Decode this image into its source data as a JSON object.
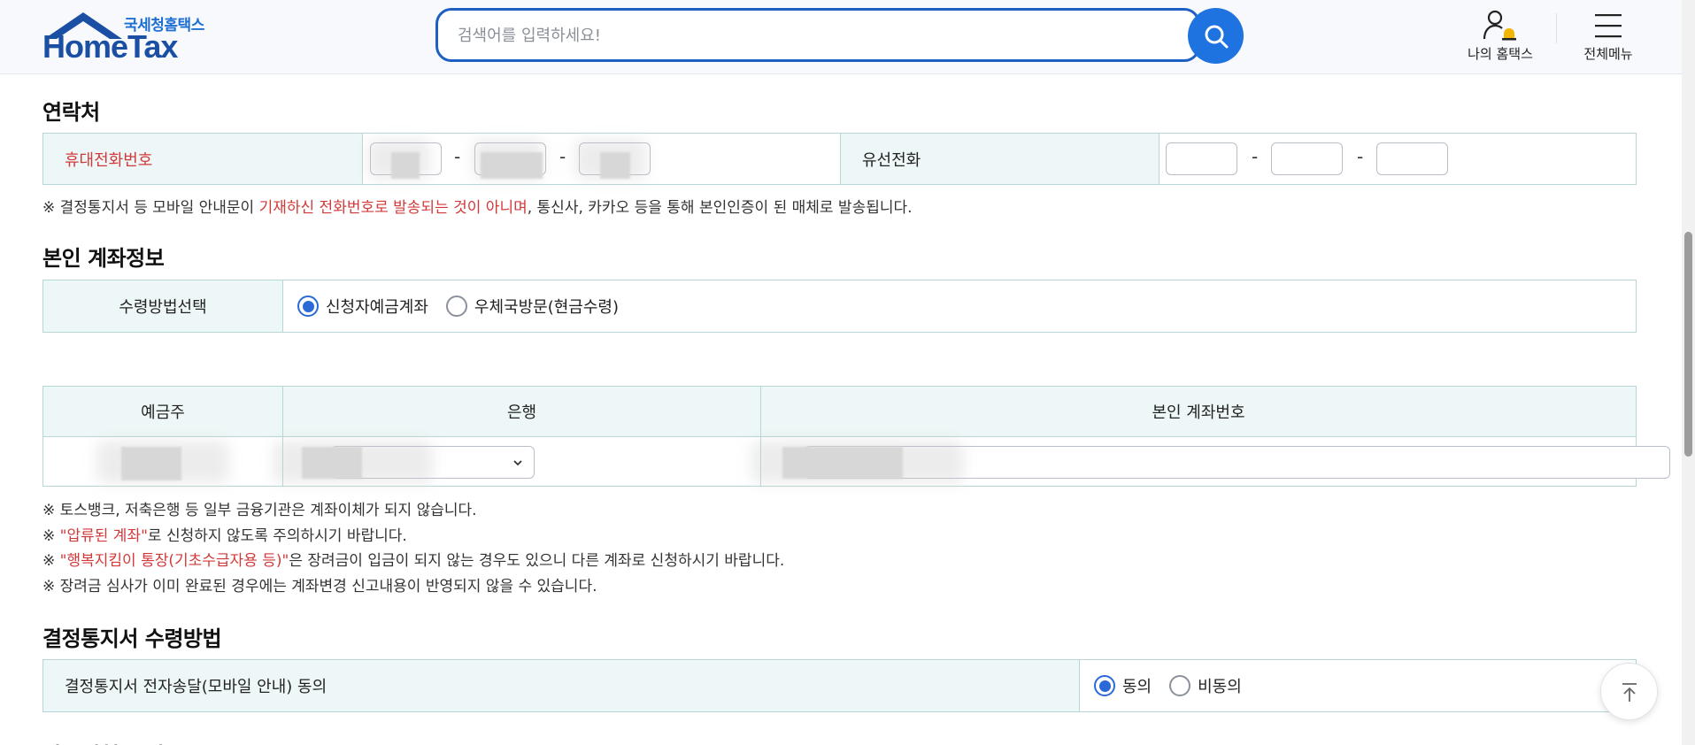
{
  "header": {
    "logo_sub": "국세청홈택스",
    "logo_main": "HomeTax",
    "search_placeholder": "검색어를 입력하세요!",
    "my_hometax": "나의 홈택스",
    "all_menu": "전체메뉴"
  },
  "contact": {
    "title": "연락처",
    "mobile_label": "휴대전화번호",
    "landline_label": "유선전화",
    "dash": "-",
    "note_prefix": "※ 결정통지서 등 모바일 안내문이 ",
    "note_red": "기재하신 전화번호로 발송되는 것이 아니며",
    "note_suffix": ", 통신사, 카카오 등을 통해 본인인증이 된 매체로 발송됩니다."
  },
  "account": {
    "title": "본인 계좌정보",
    "method_label": "수령방법선택",
    "option_deposit": "신청자예금계좌",
    "option_post": "우체국방문(현금수령)",
    "selected": "신청자예금계좌",
    "col_holder": "예금주",
    "col_bank": "은행",
    "col_number": "본인 계좌번호",
    "notes": [
      {
        "prefix": "※ 토스뱅크, 저축은행 등 일부 금융기관은 계좌이체가 되지 않습니다.",
        "red": "",
        "suffix": ""
      },
      {
        "prefix": "※ ",
        "red": "\"압류된 계좌\"",
        "suffix": "로 신청하지 않도록 주의하시기 바랍니다."
      },
      {
        "prefix": "※ ",
        "red": "\"행복지킴이 통장(기초수급자용 등)\"",
        "suffix": "은 장려금이 입금이 되지 않는 경우도 있으니 다른 계좌로 신청하시기 바랍니다."
      },
      {
        "prefix": "※ 장려금 심사가 이미 완료된 경우에는 계좌변경 신고내용이 반영되지 않을 수 있습니다.",
        "red": "",
        "suffix": ""
      }
    ]
  },
  "notice": {
    "title": "결정통지서 수령방법",
    "consent_label": "결정통지서 전자송달(모바일 안내) 동의",
    "agree": "동의",
    "disagree": "비동의",
    "selected": "동의"
  },
  "next_section_title": "자동신청 동의",
  "colors": {
    "accent": "#1f73e0",
    "table_head_bg": "#eef7f7",
    "table_border": "#b9d6d6",
    "warning_red": "#d23a3a"
  }
}
